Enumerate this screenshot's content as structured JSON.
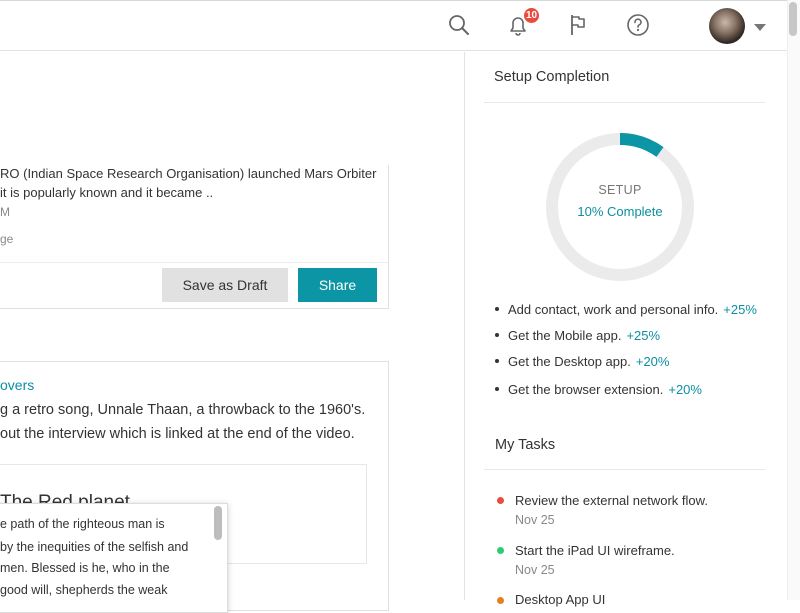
{
  "header": {
    "notification_count": "10",
    "icons": [
      "search-icon",
      "bell-icon",
      "flag-icon",
      "help-icon",
      "avatar",
      "chevron-down-icon"
    ]
  },
  "feed": {
    "post1": {
      "lines": [
        "RO (Indian Space Research Organisation) launched Mars Orbiter",
        "it is popularly known and it became .."
      ],
      "time_fragment": "M",
      "meta_fragment": "ge",
      "save_draft_label": "Save as Draft",
      "share_label": "Share"
    },
    "post2": {
      "link_text": "overs",
      "lines": [
        "g a retro song, Unnale Thaan, a throwback to the 1960's.",
        "out the interview which is linked at the end of the video."
      ],
      "inner_title": "The Red planet",
      "popup_lines": [
        "e path of the righteous man is",
        "by the inequities of the selfish and",
        "men. Blessed is he, who in the",
        "good will, shepherds the weak"
      ]
    }
  },
  "setup": {
    "heading": "Setup Completion",
    "label": "SETUP",
    "complete_text": "10% Complete",
    "progress_fraction": 0.1,
    "accent_color": "#0c95a4",
    "items": [
      {
        "text": "Add contact, work and personal info.",
        "bonus": "+25%"
      },
      {
        "text": "Get the Mobile app.",
        "bonus": "+25%"
      },
      {
        "text": "Get the Desktop app.",
        "bonus": "+20%"
      },
      {
        "text": "Get the browser extension.",
        "bonus": "+20%"
      }
    ]
  },
  "tasks": {
    "heading": "My Tasks",
    "items": [
      {
        "title": "Review the external network flow.",
        "date": "Nov 25",
        "color": "#e74c3c"
      },
      {
        "title": "Start the iPad UI wireframe.",
        "date": "Nov 25",
        "color": "#2ecc71"
      },
      {
        "title": "Desktop App UI",
        "date": "",
        "color": "#e67e22"
      }
    ]
  }
}
